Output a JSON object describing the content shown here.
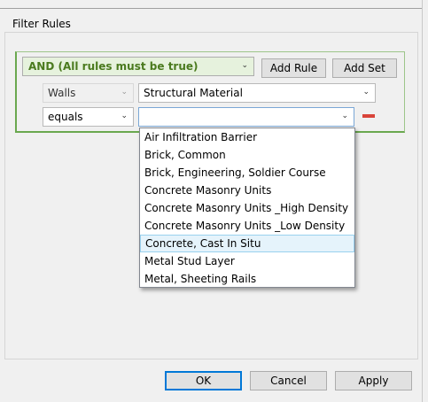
{
  "group": {
    "title": "Filter Rules"
  },
  "ruleset": {
    "logic_label": "AND (All rules must be true)",
    "add_rule_label": "Add Rule",
    "add_set_label": "Add Set",
    "colors": {
      "border": "#6aa84f",
      "logic_text": "#4a7a1e",
      "remove": "#d9443a"
    }
  },
  "rule": {
    "category": "Walls",
    "parameter": "Structural Material",
    "operator": "equals",
    "value": ""
  },
  "dropdown": {
    "options": [
      "Air Infiltration Barrier",
      "Brick, Common",
      "Brick, Engineering, Soldier Course",
      "Concrete Masonry Units",
      "Concrete Masonry Units _High Density",
      "Concrete Masonry Units _Low Density",
      "Concrete, Cast In Situ",
      "Metal Stud Layer",
      "Metal, Sheeting Rails"
    ],
    "highlighted": "Concrete, Cast In Situ"
  },
  "footer": {
    "ok_label": "OK",
    "cancel_label": "Cancel",
    "apply_label": "Apply"
  }
}
